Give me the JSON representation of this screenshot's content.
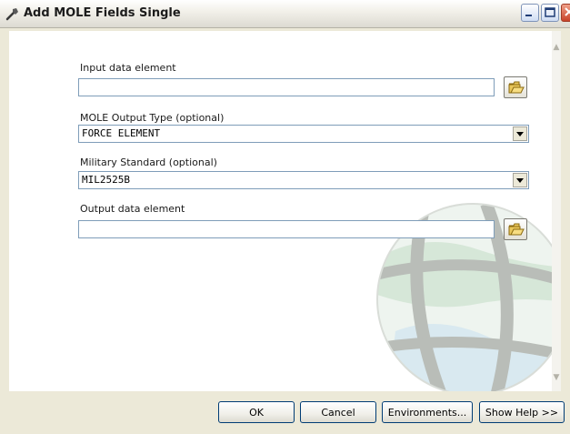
{
  "window": {
    "title": "Add MOLE Fields Single"
  },
  "fields": {
    "input_data_element": {
      "label": "Input data element",
      "value": ""
    },
    "mole_output_type": {
      "label": "MOLE Output Type (optional)",
      "value": "FORCE ELEMENT"
    },
    "military_standard": {
      "label": "Military Standard (optional)",
      "value": "MIL2525B"
    },
    "output_data_element": {
      "label": "Output data element",
      "value": ""
    }
  },
  "buttons": {
    "ok": "OK",
    "cancel": "Cancel",
    "environments": "Environments...",
    "show_help": "Show Help >>"
  },
  "icons": {
    "title": "tool-icon",
    "browse": "open-folder-icon",
    "dropdown": "chevron-down-icon",
    "background": "globe-watermark"
  },
  "colors": {
    "dialog_bg": "#ece9d8",
    "content_bg": "#ffffff",
    "input_border": "#7f9db9",
    "button_border": "#003c74",
    "close_button": "#c8432a"
  }
}
